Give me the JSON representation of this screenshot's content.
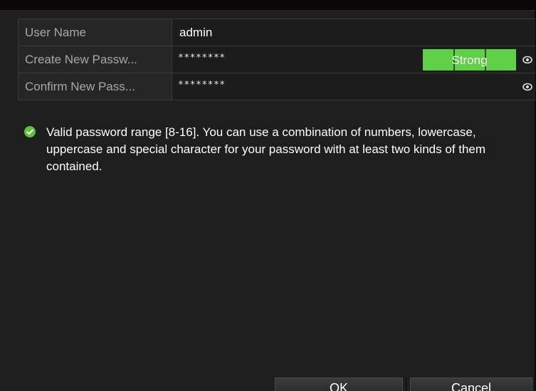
{
  "form": {
    "rows": [
      {
        "label": "User Name",
        "value": "admin"
      },
      {
        "label": "Create New Passw...",
        "value": "********",
        "strength": "Strong"
      },
      {
        "label": "Confirm New Pass...",
        "value": "********"
      }
    ]
  },
  "notice": {
    "text": "Valid password range [8-16]. You can use a combination of numbers, lowercase, uppercase and special character for your password with at least two kinds of them contained."
  },
  "buttons": {
    "ok": "OK",
    "cancel": "Cancel"
  },
  "colors": {
    "strength_strong": "#5fd048",
    "check_icon": "#5fbf3f"
  },
  "icons": {
    "reveal": "eye-icon",
    "status": "check-circle-icon"
  }
}
